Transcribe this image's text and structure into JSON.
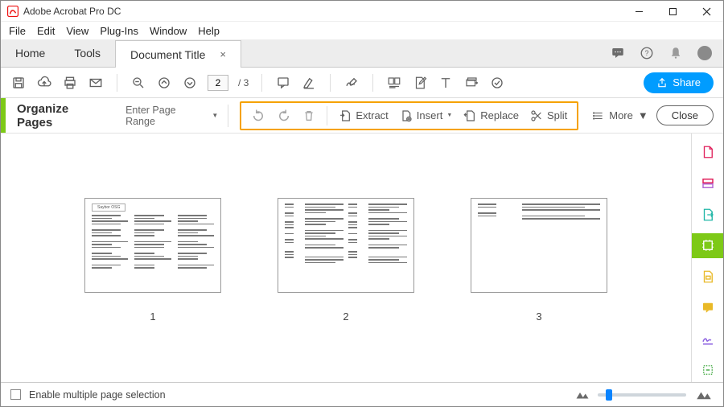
{
  "app": {
    "title": "Adobe Acrobat Pro DC"
  },
  "menu": {
    "items": [
      "File",
      "Edit",
      "View",
      "Plug-Ins",
      "Window",
      "Help"
    ]
  },
  "tabs": {
    "home": "Home",
    "tools": "Tools",
    "document": "Document Title"
  },
  "toolbar": {
    "current_page": "2",
    "page_total": "/ 3",
    "share_label": "Share"
  },
  "organize": {
    "title": "Organize Pages",
    "page_range_placeholder": "Enter Page Range",
    "extract": "Extract",
    "insert": "Insert",
    "replace": "Replace",
    "split": "Split",
    "more": "More",
    "close": "Close"
  },
  "pages": {
    "numbers": [
      "1",
      "2",
      "3"
    ],
    "thumb1_header": "Saybor  OSG"
  },
  "footer": {
    "checkbox_label": "Enable multiple page selection"
  },
  "colors": {
    "accent_green": "#7dc917",
    "highlight_orange": "#f5a200",
    "share_blue": "#009cff"
  }
}
